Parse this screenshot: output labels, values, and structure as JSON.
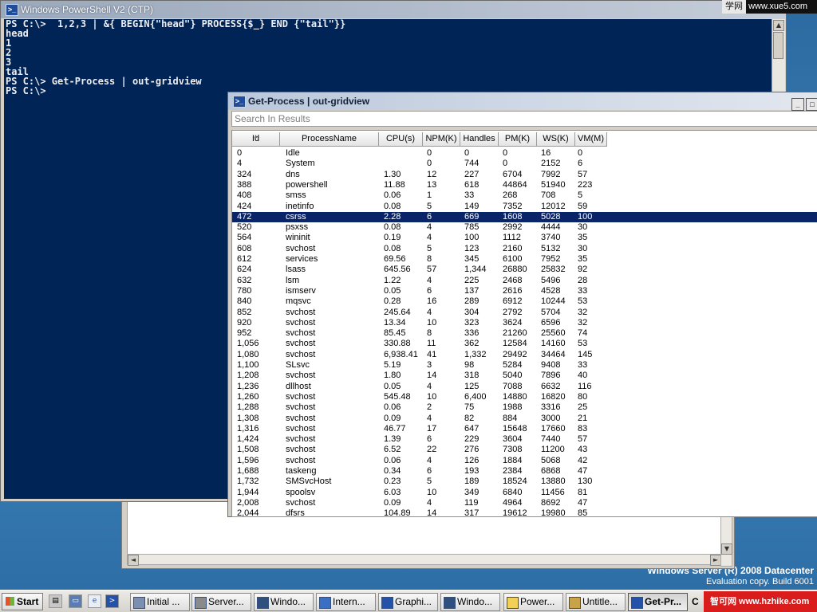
{
  "desktop": {
    "os_line1": "Windows Server (R) 2008 Datacenter",
    "os_line2": "Evaluation copy. Build 6001"
  },
  "ps_window": {
    "title": "Windows PowerShell V2 (CTP)",
    "console_lines": [
      "PS C:\\>  1,2,3 | &{ BEGIN{\"head\"} PROCESS{$_} END {\"tail\"}}",
      "head",
      "1",
      "2",
      "3",
      "tail",
      "PS C:\\> Get-Process | out-gridview",
      "PS C:\\>"
    ]
  },
  "gridview": {
    "title": "Get-Process | out-gridview",
    "search_placeholder": "Search In Results",
    "columns": [
      "Id",
      "ProcessName",
      "CPU(s)",
      "NPM(K)",
      "Handles",
      "PM(K)",
      "WS(K)",
      "VM(M)"
    ],
    "selected_row": 6,
    "rows": [
      [
        "0",
        "Idle",
        "",
        "0",
        "0",
        "0",
        "16",
        "0"
      ],
      [
        "4",
        "System",
        "",
        "0",
        "744",
        "0",
        "2152",
        "6"
      ],
      [
        "324",
        "dns",
        "1.30",
        "12",
        "227",
        "6704",
        "7992",
        "57"
      ],
      [
        "388",
        "powershell",
        "11.88",
        "13",
        "618",
        "44864",
        "51940",
        "223"
      ],
      [
        "408",
        "smss",
        "0.06",
        "1",
        "33",
        "268",
        "708",
        "5"
      ],
      [
        "424",
        "inetinfo",
        "0.08",
        "5",
        "149",
        "7352",
        "12012",
        "59"
      ],
      [
        "472",
        "csrss",
        "2.28",
        "6",
        "669",
        "1608",
        "5028",
        "100"
      ],
      [
        "520",
        "psxss",
        "0.08",
        "4",
        "785",
        "2992",
        "4444",
        "30"
      ],
      [
        "564",
        "wininit",
        "0.19",
        "4",
        "100",
        "1112",
        "3740",
        "35"
      ],
      [
        "608",
        "svchost",
        "0.08",
        "5",
        "123",
        "2160",
        "5132",
        "30"
      ],
      [
        "612",
        "services",
        "69.56",
        "8",
        "345",
        "6100",
        "7952",
        "35"
      ],
      [
        "624",
        "lsass",
        "645.56",
        "57",
        "1,344",
        "26880",
        "25832",
        "92"
      ],
      [
        "632",
        "lsm",
        "1.22",
        "4",
        "225",
        "2468",
        "5496",
        "28"
      ],
      [
        "780",
        "ismserv",
        "0.05",
        "6",
        "137",
        "2616",
        "4528",
        "33"
      ],
      [
        "840",
        "mqsvc",
        "0.28",
        "16",
        "289",
        "6912",
        "10244",
        "53"
      ],
      [
        "852",
        "svchost",
        "245.64",
        "4",
        "304",
        "2792",
        "5704",
        "32"
      ],
      [
        "920",
        "svchost",
        "13.34",
        "10",
        "323",
        "3624",
        "6596",
        "32"
      ],
      [
        "952",
        "svchost",
        "85.45",
        "8",
        "336",
        "21260",
        "25560",
        "74"
      ],
      [
        "1,056",
        "svchost",
        "330.88",
        "11",
        "362",
        "12584",
        "14160",
        "53"
      ],
      [
        "1,080",
        "svchost",
        "6,938.41",
        "41",
        "1,332",
        "29492",
        "34464",
        "145"
      ],
      [
        "1,100",
        "SLsvc",
        "5.19",
        "3",
        "98",
        "5284",
        "9408",
        "33"
      ],
      [
        "1,208",
        "svchost",
        "1.80",
        "14",
        "318",
        "5040",
        "7896",
        "40"
      ],
      [
        "1,236",
        "dllhost",
        "0.05",
        "4",
        "125",
        "7088",
        "6632",
        "116"
      ],
      [
        "1,260",
        "svchost",
        "545.48",
        "10",
        "6,400",
        "14880",
        "16820",
        "80"
      ],
      [
        "1,288",
        "svchost",
        "0.06",
        "2",
        "75",
        "1988",
        "3316",
        "25"
      ],
      [
        "1,308",
        "svchost",
        "0.09",
        "4",
        "82",
        "884",
        "3000",
        "21"
      ],
      [
        "1,316",
        "svchost",
        "46.77",
        "17",
        "647",
        "15648",
        "17660",
        "83"
      ],
      [
        "1,424",
        "svchost",
        "1.39",
        "6",
        "229",
        "3604",
        "7440",
        "57"
      ],
      [
        "1,508",
        "svchost",
        "6.52",
        "22",
        "276",
        "7308",
        "11200",
        "43"
      ],
      [
        "1,596",
        "svchost",
        "0.06",
        "4",
        "126",
        "1884",
        "5068",
        "42"
      ],
      [
        "1,688",
        "taskeng",
        "0.34",
        "6",
        "193",
        "2384",
        "6868",
        "47"
      ],
      [
        "1,732",
        "SMSvcHost",
        "0.23",
        "5",
        "189",
        "18524",
        "13880",
        "130"
      ],
      [
        "1,944",
        "spoolsv",
        "6.03",
        "10",
        "349",
        "6840",
        "11456",
        "81"
      ],
      [
        "2,008",
        "svchost",
        "0.09",
        "4",
        "119",
        "4964",
        "8692",
        "47"
      ],
      [
        "2,044",
        "dfsrs",
        "104.89",
        "14",
        "317",
        "19612",
        "19980",
        "85"
      ]
    ]
  },
  "taskbar": {
    "start_label": "Start",
    "buttons": [
      "Initial ...",
      "Server...",
      "Windo...",
      "Intern...",
      "Graphi...",
      "Windo...",
      "Power...",
      "Untitle...",
      "Get-Pr..."
    ],
    "clock_fragment": "C"
  },
  "watermarks": {
    "top_a": "学网",
    "top_b": "www.xue5.com",
    "bottom": "智可网 www.hzhike.com"
  },
  "colors": {
    "console_bg": "#012456",
    "selection": "#0a246a"
  }
}
